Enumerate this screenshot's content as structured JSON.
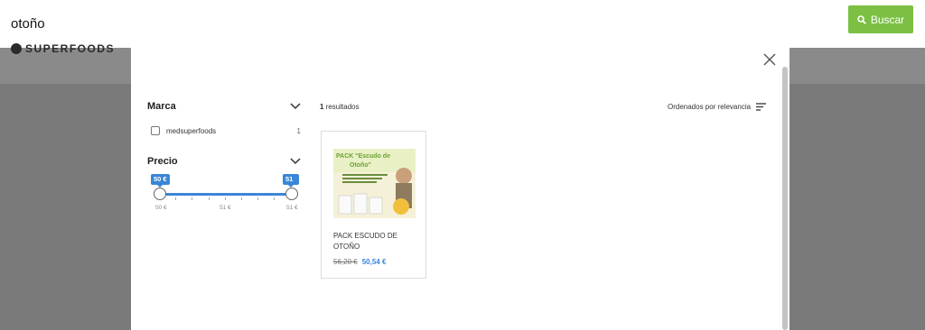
{
  "search": {
    "query": "otoño",
    "button_label": "Buscar"
  },
  "site": {
    "logo_text": "SUPERFOODS"
  },
  "filters": {
    "brand": {
      "title": "Marca",
      "items": [
        {
          "label": "medsuperfoods",
          "count": "1",
          "checked": false
        }
      ]
    },
    "price": {
      "title": "Precio",
      "min_bubble": "50 €",
      "max_bubble": "51 €",
      "tick_labels": [
        "50 €",
        "51 €",
        "51 €"
      ]
    }
  },
  "results": {
    "count": "1",
    "count_suffix": "resultados",
    "sort_label": "Ordenados por relevancia",
    "products": [
      {
        "name": "PACK ESCUDO DE OTOÑO",
        "old_price": "56,20 €",
        "new_price": "50,54 €",
        "image_title_1": "PACK \"Escudo de",
        "image_title_2": "Otoño\""
      }
    ]
  },
  "colors": {
    "accent_green": "#7cc043",
    "accent_blue": "#3a86d8",
    "overlay": "#7a7a7a"
  },
  "icons": {
    "search": "search-icon",
    "close": "close-icon",
    "chevron": "chevron-down-icon",
    "sort": "sort-icon"
  }
}
